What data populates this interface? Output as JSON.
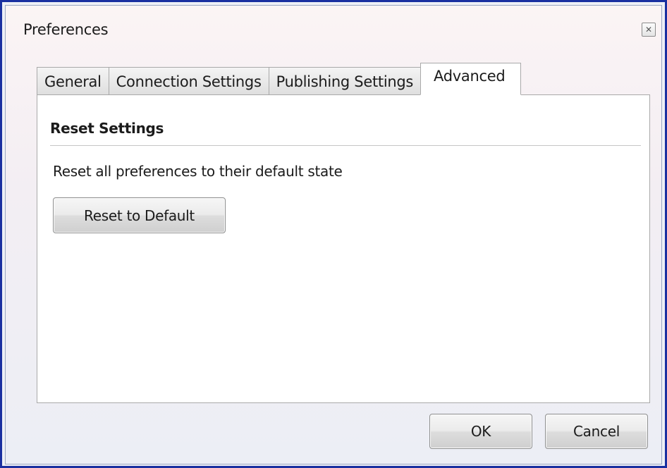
{
  "window": {
    "title": "Preferences",
    "close_icon": "close-icon"
  },
  "tabs": [
    {
      "label": "General",
      "active": false
    },
    {
      "label": "Connection Settings",
      "active": false
    },
    {
      "label": "Publishing Settings",
      "active": false
    },
    {
      "label": "Advanced",
      "active": true
    }
  ],
  "advanced": {
    "section_title": "Reset Settings",
    "description": "Reset all preferences to their default state",
    "reset_button_label": "Reset to Default"
  },
  "footer": {
    "ok_label": "OK",
    "cancel_label": "Cancel"
  },
  "colors": {
    "frame_border": "#1a2fa0",
    "panel_background": "#ffffff",
    "tab_border": "#a9a9a9"
  }
}
